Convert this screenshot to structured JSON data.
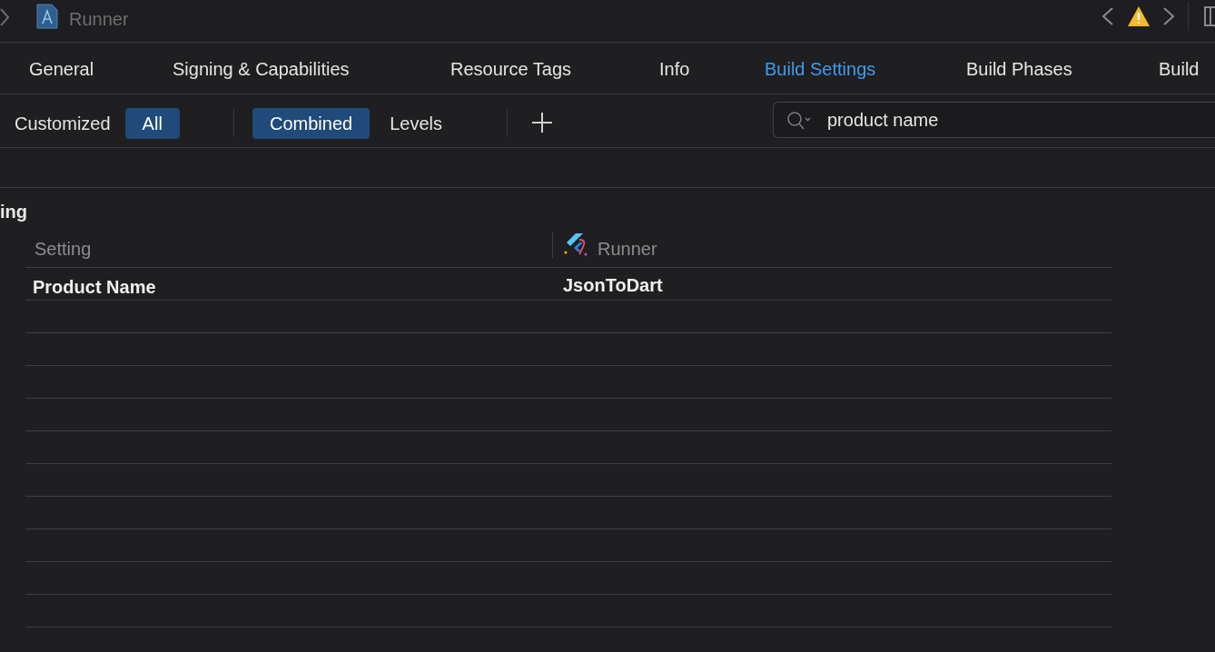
{
  "titlebar": {
    "title": "Runner"
  },
  "tabs": [
    {
      "label": "General",
      "selected": false
    },
    {
      "label": "Signing & Capabilities",
      "selected": false
    },
    {
      "label": "Resource Tags",
      "selected": false
    },
    {
      "label": "Info",
      "selected": false
    },
    {
      "label": "Build Settings",
      "selected": true
    },
    {
      "label": "Build Phases",
      "selected": false
    },
    {
      "label": "Build",
      "selected": false
    }
  ],
  "filters": {
    "scope": [
      {
        "label": "Customized",
        "selected": false
      },
      {
        "label": "All",
        "selected": true
      }
    ],
    "view": [
      {
        "label": "Combined",
        "selected": true
      },
      {
        "label": "Levels",
        "selected": false
      }
    ]
  },
  "search": {
    "value": "product name"
  },
  "section": {
    "title": "ing"
  },
  "table": {
    "columns": [
      "Setting",
      "Runner"
    ],
    "rows": [
      {
        "setting": "Product Name",
        "value": "JsonToDart"
      }
    ]
  }
}
